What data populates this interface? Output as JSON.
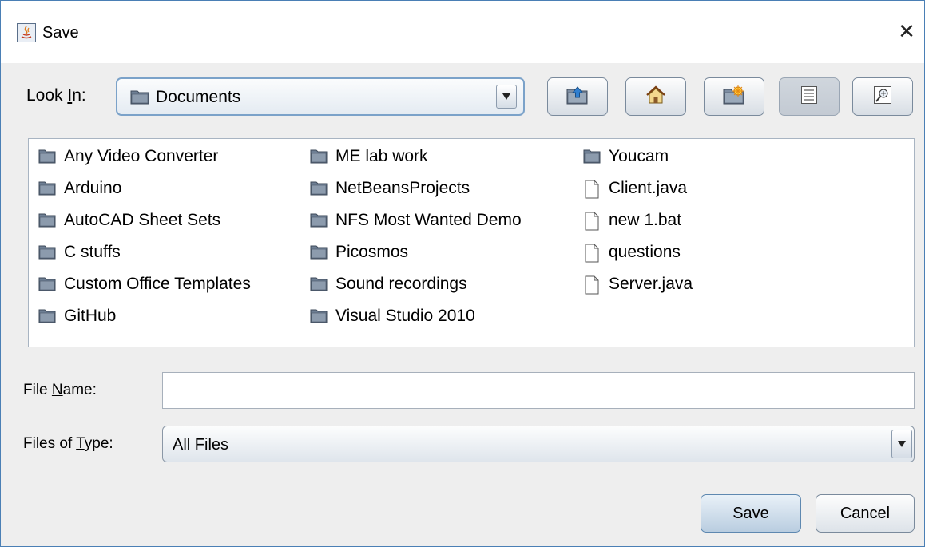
{
  "window": {
    "title": "Save",
    "close_glyph": "✕"
  },
  "toolbar": {
    "look_in_pre": "Look ",
    "look_in_mnemonic": "I",
    "look_in_post": "n:",
    "look_in_value": "Documents",
    "buttons": [
      {
        "name": "up-one-level-button",
        "icon": "folder-up-icon"
      },
      {
        "name": "home-button",
        "icon": "home-icon"
      },
      {
        "name": "create-new-folder-button",
        "icon": "new-folder-icon"
      },
      {
        "name": "list-view-button",
        "icon": "list-view-icon"
      },
      {
        "name": "details-view-button",
        "icon": "details-view-icon"
      }
    ]
  },
  "files": {
    "column1": [
      "Any Video Converter",
      "Arduino",
      "AutoCAD Sheet Sets",
      "C stuffs",
      "Custom Office Templates",
      "GitHub"
    ],
    "column2": [
      "ME lab work",
      "NetBeansProjects",
      "NFS Most Wanted Demo",
      "Picosmos",
      "Sound recordings",
      "Visual Studio 2010"
    ],
    "column3_folders": [
      "Youcam"
    ],
    "column3_files": [
      "Client.java",
      "new 1.bat",
      "questions",
      "Server.java"
    ]
  },
  "form": {
    "file_name_pre": "File ",
    "file_name_mnemonic": "N",
    "file_name_post": "ame:",
    "file_name_value": "",
    "file_type_pre": "Files of ",
    "file_type_mnemonic": "T",
    "file_type_post": "ype:",
    "file_type_value": "All Files"
  },
  "actions": {
    "save_label": "Save",
    "cancel_label": "Cancel"
  },
  "colors": {
    "window_border": "#4a7fb5",
    "panel_bg": "#eeeeee",
    "folder_fill": "#6e7f94"
  }
}
